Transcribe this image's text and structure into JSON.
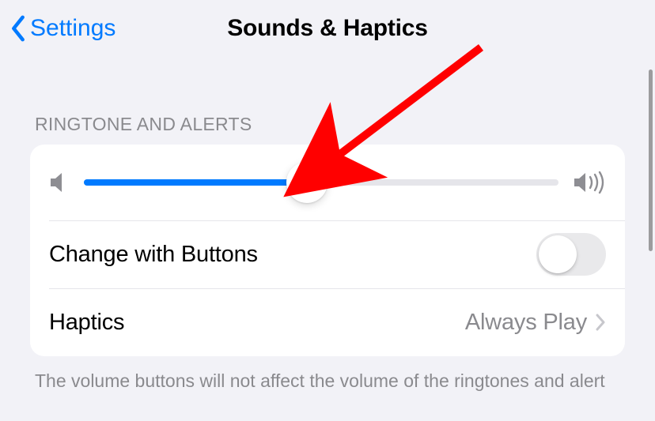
{
  "nav": {
    "back_label": "Settings",
    "title": "Sounds & Haptics"
  },
  "section": {
    "header": "RINGTONE AND ALERTS",
    "slider_percent": 47,
    "rows": {
      "change_buttons_label": "Change with Buttons",
      "change_buttons_on": false,
      "haptics_label": "Haptics",
      "haptics_value": "Always Play"
    },
    "footer": "The volume buttons will not affect the volume of the ringtones and alert"
  },
  "annotation": {
    "arrow_color": "#ff0000"
  }
}
